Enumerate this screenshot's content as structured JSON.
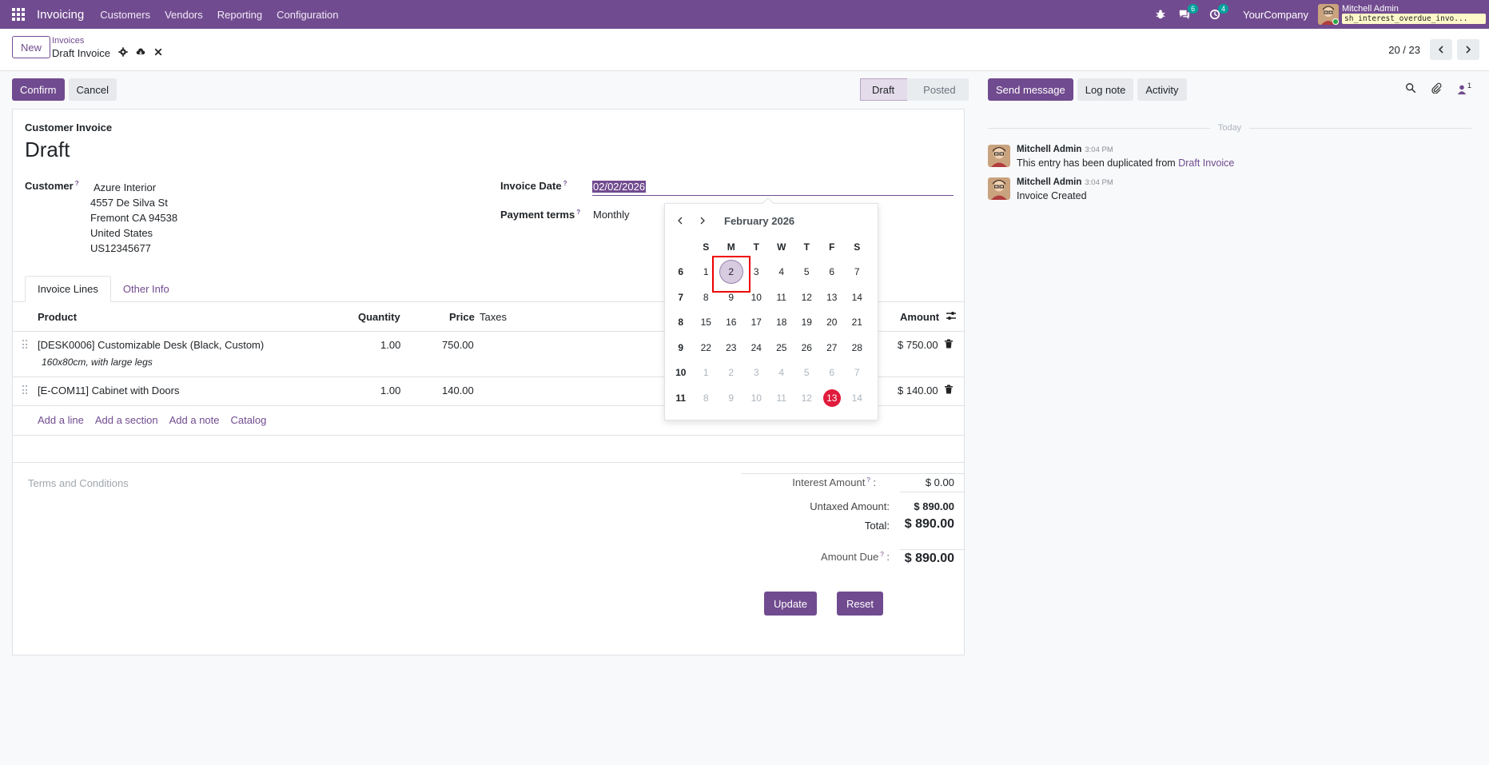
{
  "navbar": {
    "app_name": "Invoicing",
    "menus": [
      "Customers",
      "Vendors",
      "Reporting",
      "Configuration"
    ],
    "messages_count": "6",
    "activities_count": "4",
    "company": "YourCompany",
    "user_name": "Mitchell Admin",
    "db_name": "sh_interest_overdue_invo..."
  },
  "control_panel": {
    "new_label": "New",
    "breadcrumb_parent": "Invoices",
    "breadcrumb_current": "Draft Invoice",
    "pager": "20 / 23"
  },
  "actions": {
    "confirm_label": "Confirm",
    "cancel_label": "Cancel",
    "status_steps": [
      "Draft",
      "Posted"
    ],
    "active_status": "Draft"
  },
  "form": {
    "type_label": "Customer Invoice",
    "title": "Draft",
    "customer_label": "Customer",
    "customer_help": "?",
    "customer_name": "Azure Interior",
    "customer_address": [
      "4557 De Silva St",
      "Fremont CA 94538",
      "United States",
      "US12345677"
    ],
    "invoice_date_label": "Invoice Date",
    "invoice_date_value": "02/02/2026",
    "payment_terms_label": "Payment terms",
    "payment_terms_value": "Monthly"
  },
  "tabs": [
    "Invoice Lines",
    "Other Info"
  ],
  "lines": {
    "headers": {
      "product": "Product",
      "quantity": "Quantity",
      "price": "Price",
      "taxes": "Taxes",
      "amount": "Amount"
    },
    "rows": [
      {
        "product": "[DESK0006] Customizable Desk (Black, Custom)",
        "description": "160x80cm, with large legs",
        "quantity": "1.00",
        "price": "750.00",
        "amount": "$ 750.00"
      },
      {
        "product": "[E-COM11] Cabinet with Doors",
        "description": "",
        "quantity": "1.00",
        "price": "140.00",
        "amount": "$ 140.00"
      }
    ],
    "add_links": [
      "Add a line",
      "Add a section",
      "Add a note",
      "Catalog"
    ]
  },
  "terms_placeholder": "Terms and Conditions",
  "totals": {
    "interest_label": "Interest Amount",
    "interest_value": "$ 0.00",
    "untaxed_label": "Untaxed Amount:",
    "untaxed_value": "$ 890.00",
    "total_label": "Total:",
    "total_value": "$ 890.00",
    "due_label": "Amount Due",
    "due_value": "$ 890.00",
    "update_label": "Update",
    "reset_label": "Reset"
  },
  "datepicker": {
    "month_label": "February 2026",
    "day_headers": [
      "S",
      "M",
      "T",
      "W",
      "T",
      "F",
      "S"
    ],
    "weeks": [
      {
        "week": "6",
        "days": [
          "1",
          "2",
          "3",
          "4",
          "5",
          "6",
          "7"
        ]
      },
      {
        "week": "7",
        "days": [
          "8",
          "9",
          "10",
          "11",
          "12",
          "13",
          "14"
        ]
      },
      {
        "week": "8",
        "days": [
          "15",
          "16",
          "17",
          "18",
          "19",
          "20",
          "21"
        ]
      },
      {
        "week": "9",
        "days": [
          "22",
          "23",
          "24",
          "25",
          "26",
          "27",
          "28"
        ]
      },
      {
        "week": "10",
        "days": [
          "1",
          "2",
          "3",
          "4",
          "5",
          "6",
          "7"
        ]
      },
      {
        "week": "11",
        "days": [
          "8",
          "9",
          "10",
          "11",
          "12",
          "13",
          "14"
        ]
      }
    ],
    "selected_day": "2",
    "today_day": "13"
  },
  "chatter": {
    "send_message_label": "Send message",
    "log_note_label": "Log note",
    "activity_label": "Activity",
    "followers_count": "1",
    "date_separator": "Today",
    "messages": [
      {
        "author": "Mitchell Admin",
        "time": "3:04 PM",
        "body": "This entry has been duplicated from",
        "link": "Draft Invoice"
      },
      {
        "author": "Mitchell Admin",
        "time": "3:04 PM",
        "body": "Invoice Created",
        "link": ""
      }
    ]
  },
  "colors": {
    "brand": "#714b8f",
    "today": "#e01b3c",
    "teal_badge": "#00a09d"
  }
}
